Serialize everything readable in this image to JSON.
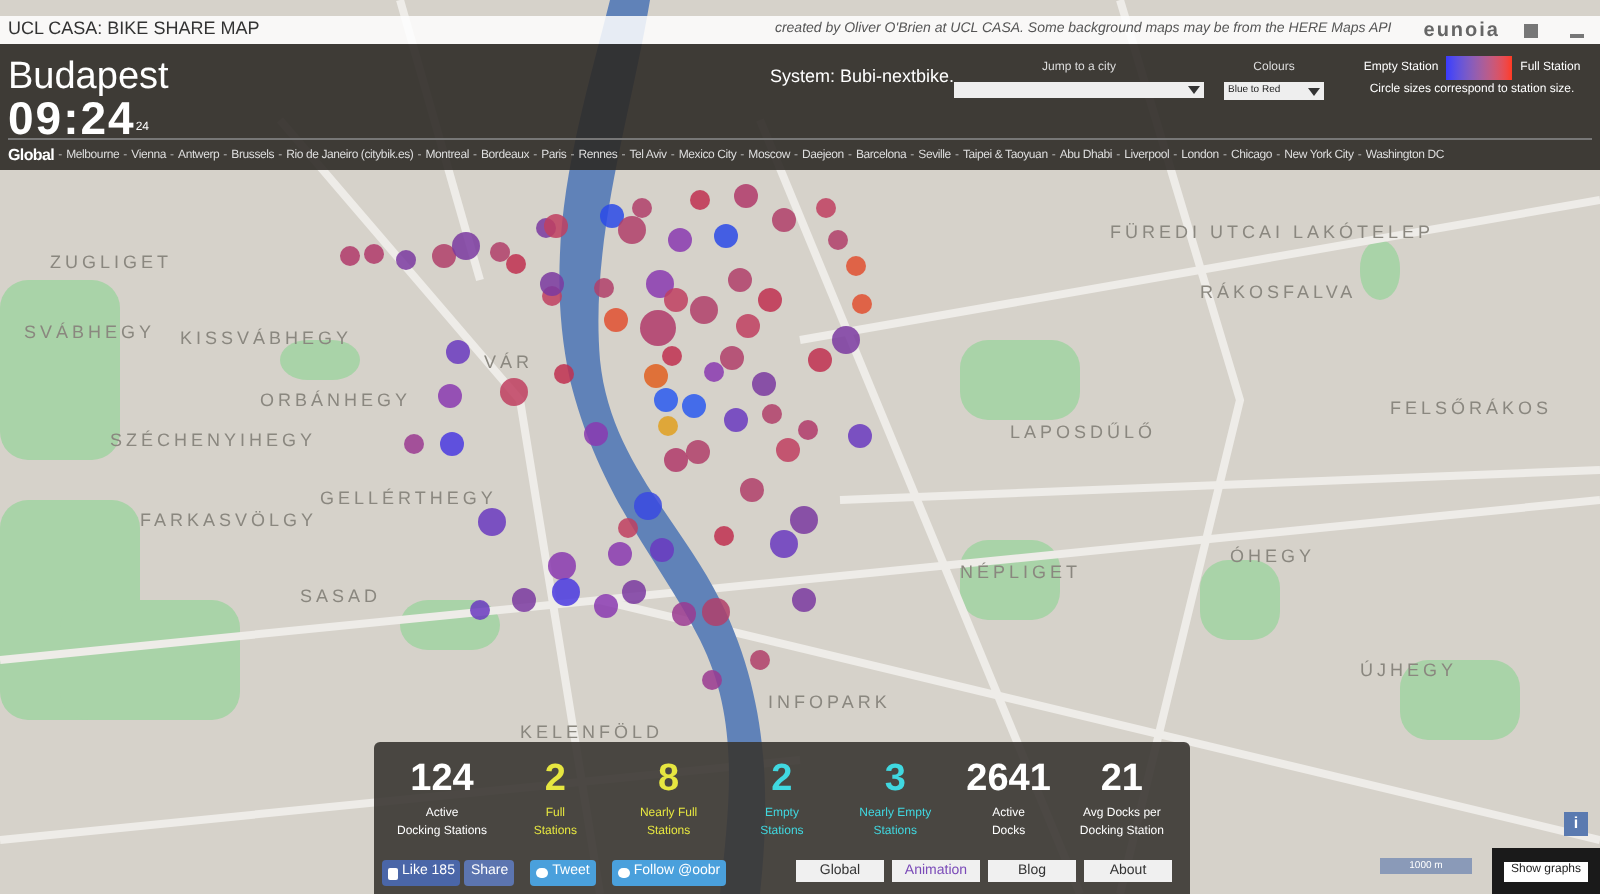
{
  "header": {
    "title": "UCL CASA: BIKE SHARE MAP",
    "credit": "created by Oliver O'Brien at UCL CASA. Some background maps may be from the HERE Maps API",
    "logo": "eunoia"
  },
  "panel": {
    "city": "Budapest",
    "time": "09:24",
    "seconds": "24",
    "system": "System: Bubi-nextbike.",
    "jump": {
      "label": "Jump to a city"
    },
    "colours": {
      "label": "Colours",
      "value": "Blue to Red"
    },
    "legend": {
      "empty": "Empty Station",
      "full": "Full Station",
      "note": "Circle sizes correspond to station size."
    },
    "separator": "-",
    "cities": [
      {
        "label": "Global",
        "selected": true
      },
      {
        "label": "Melbourne",
        "selected": false
      },
      {
        "label": "Vienna",
        "selected": false
      },
      {
        "label": "Antwerp",
        "selected": false
      },
      {
        "label": "Brussels",
        "selected": false
      },
      {
        "label": "Rio de Janeiro (citybik.es)",
        "selected": false
      },
      {
        "label": "Montreal",
        "selected": false
      },
      {
        "label": "Bordeaux",
        "selected": false
      },
      {
        "label": "Paris",
        "selected": false
      },
      {
        "label": "Rennes",
        "selected": false
      },
      {
        "label": "Tel Aviv",
        "selected": false
      },
      {
        "label": "Mexico City",
        "selected": false
      },
      {
        "label": "Moscow",
        "selected": false
      },
      {
        "label": "Daejeon",
        "selected": false
      },
      {
        "label": "Barcelona",
        "selected": false
      },
      {
        "label": "Seville",
        "selected": false
      },
      {
        "label": "Taipei & Taoyuan",
        "selected": false
      },
      {
        "label": "Abu Dhabi",
        "selected": false
      },
      {
        "label": "Liverpool",
        "selected": false
      },
      {
        "label": "London",
        "selected": false
      },
      {
        "label": "Chicago",
        "selected": false
      },
      {
        "label": "New York City",
        "selected": false
      },
      {
        "label": "Washington DC",
        "selected": false
      }
    ]
  },
  "map": {
    "labels": [
      "ZUGLIGET",
      "SVÁBHEGY",
      "KISSVÁBHEGY",
      "VÁR",
      "ORBÁNHEGY",
      "SZÉCHENYIHEGY",
      "FARKASVÖLGY",
      "GELLÉRTHEGY",
      "SASAD",
      "INFOPARK",
      "KELENFÖLD",
      "FÜREDI UTCAI LAKÓTELEP",
      "RÁKOSFALVA",
      "FELSŐRÁKOS",
      "NÉPLIGET",
      "LAPOSDŰLŐ",
      "ÓHEGY",
      "ÚJHEGY"
    ],
    "scale": "1000 m",
    "info": "i"
  },
  "stats": [
    {
      "value": "124",
      "label": [
        "Active",
        "Docking Stations"
      ],
      "color": "#ffffff"
    },
    {
      "value": "2",
      "label": [
        "Full",
        "Stations"
      ],
      "color": "#e6e640"
    },
    {
      "value": "8",
      "label": [
        "Nearly Full",
        "Stations"
      ],
      "color": "#e6e640"
    },
    {
      "value": "2",
      "label": [
        "Empty",
        "Stations"
      ],
      "color": "#40d8e0"
    },
    {
      "value": "3",
      "label": [
        "Nearly Empty",
        "Stations"
      ],
      "color": "#40d8e0"
    },
    {
      "value": "2641",
      "label": [
        "Active",
        "Docks"
      ],
      "color": "#ffffff"
    },
    {
      "value": "21",
      "label": [
        "Avg Docks per",
        "Docking Station"
      ],
      "color": "#ffffff"
    }
  ],
  "social": [
    {
      "kind": "like",
      "label": "Like 185"
    },
    {
      "kind": "share",
      "label": "Share"
    },
    {
      "kind": "tweet",
      "label": "Tweet"
    },
    {
      "kind": "follow",
      "label": "Follow @oobr"
    }
  ],
  "nav": [
    {
      "label": "Global",
      "selected": false
    },
    {
      "label": "Animation",
      "selected": true
    },
    {
      "label": "Blog",
      "selected": false
    },
    {
      "label": "About",
      "selected": false
    }
  ],
  "graphs_button": "Show graphs"
}
